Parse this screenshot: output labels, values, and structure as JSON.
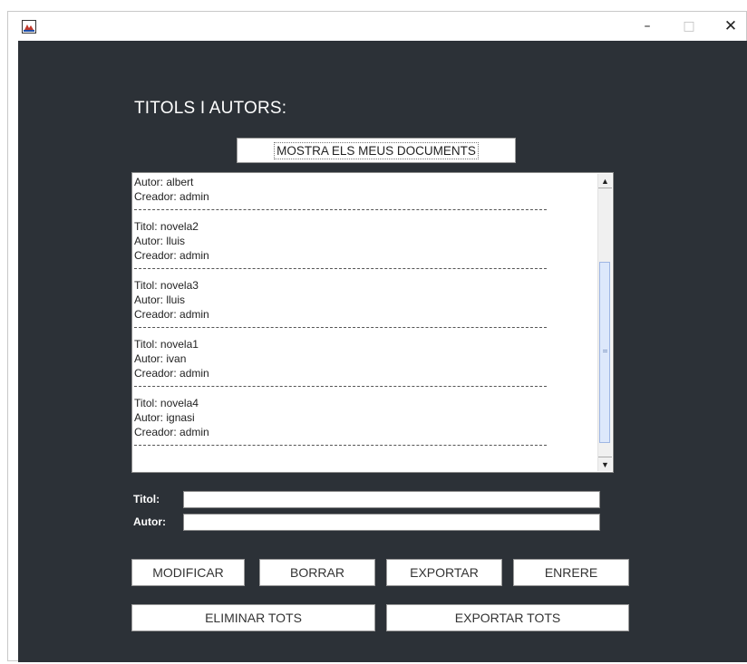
{
  "window": {
    "controls": {
      "minimize": "–",
      "maximize": "□",
      "close": "✕"
    }
  },
  "heading": "TITOLS I AUTORS:",
  "show_docs_button": "MOSTRA ELS MEUS DOCUMENTS",
  "list": {
    "entries": [
      [
        "Autor: albert",
        "Creador: admin"
      ],
      [
        "Titol: novela2",
        "Autor: lluis",
        "Creador: admin"
      ],
      [
        "Titol: novela3",
        "Autor: lluis",
        "Creador: admin"
      ],
      [
        "Titol: novela1",
        "Autor: ivan",
        "Creador: admin"
      ],
      [
        "Titol: novela4",
        "Autor: ignasi",
        "Creador: admin"
      ]
    ],
    "scroll_position": 0.82
  },
  "form": {
    "title_label": "Titol:",
    "title_value": "",
    "author_label": "Autor:",
    "author_value": ""
  },
  "buttons": {
    "modify": "MODIFICAR",
    "delete": "BORRAR",
    "export": "EXPORTAR",
    "back": "ENRERE",
    "delete_all": "ELIMINAR TOTS",
    "export_all": "EXPORTAR TOTS"
  },
  "colors": {
    "background": "#2c3137",
    "scroll_thumb": "#dde8fb"
  }
}
